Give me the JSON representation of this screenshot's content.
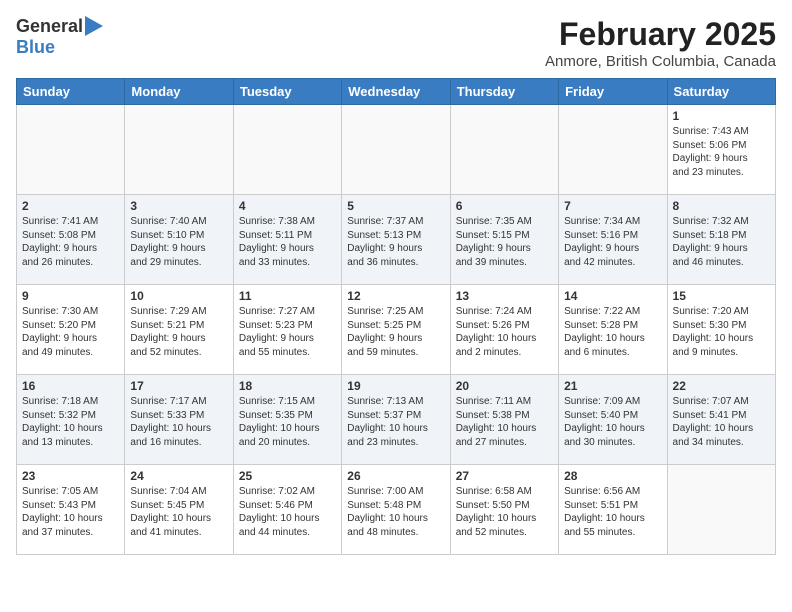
{
  "header": {
    "logo_general": "General",
    "logo_blue": "Blue",
    "title": "February 2025",
    "location": "Anmore, British Columbia, Canada"
  },
  "weekdays": [
    "Sunday",
    "Monday",
    "Tuesday",
    "Wednesday",
    "Thursday",
    "Friday",
    "Saturday"
  ],
  "weeks": [
    [
      {
        "day": "",
        "info": ""
      },
      {
        "day": "",
        "info": ""
      },
      {
        "day": "",
        "info": ""
      },
      {
        "day": "",
        "info": ""
      },
      {
        "day": "",
        "info": ""
      },
      {
        "day": "",
        "info": ""
      },
      {
        "day": "1",
        "info": "Sunrise: 7:43 AM\nSunset: 5:06 PM\nDaylight: 9 hours\nand 23 minutes."
      }
    ],
    [
      {
        "day": "2",
        "info": "Sunrise: 7:41 AM\nSunset: 5:08 PM\nDaylight: 9 hours\nand 26 minutes."
      },
      {
        "day": "3",
        "info": "Sunrise: 7:40 AM\nSunset: 5:10 PM\nDaylight: 9 hours\nand 29 minutes."
      },
      {
        "day": "4",
        "info": "Sunrise: 7:38 AM\nSunset: 5:11 PM\nDaylight: 9 hours\nand 33 minutes."
      },
      {
        "day": "5",
        "info": "Sunrise: 7:37 AM\nSunset: 5:13 PM\nDaylight: 9 hours\nand 36 minutes."
      },
      {
        "day": "6",
        "info": "Sunrise: 7:35 AM\nSunset: 5:15 PM\nDaylight: 9 hours\nand 39 minutes."
      },
      {
        "day": "7",
        "info": "Sunrise: 7:34 AM\nSunset: 5:16 PM\nDaylight: 9 hours\nand 42 minutes."
      },
      {
        "day": "8",
        "info": "Sunrise: 7:32 AM\nSunset: 5:18 PM\nDaylight: 9 hours\nand 46 minutes."
      }
    ],
    [
      {
        "day": "9",
        "info": "Sunrise: 7:30 AM\nSunset: 5:20 PM\nDaylight: 9 hours\nand 49 minutes."
      },
      {
        "day": "10",
        "info": "Sunrise: 7:29 AM\nSunset: 5:21 PM\nDaylight: 9 hours\nand 52 minutes."
      },
      {
        "day": "11",
        "info": "Sunrise: 7:27 AM\nSunset: 5:23 PM\nDaylight: 9 hours\nand 55 minutes."
      },
      {
        "day": "12",
        "info": "Sunrise: 7:25 AM\nSunset: 5:25 PM\nDaylight: 9 hours\nand 59 minutes."
      },
      {
        "day": "13",
        "info": "Sunrise: 7:24 AM\nSunset: 5:26 PM\nDaylight: 10 hours\nand 2 minutes."
      },
      {
        "day": "14",
        "info": "Sunrise: 7:22 AM\nSunset: 5:28 PM\nDaylight: 10 hours\nand 6 minutes."
      },
      {
        "day": "15",
        "info": "Sunrise: 7:20 AM\nSunset: 5:30 PM\nDaylight: 10 hours\nand 9 minutes."
      }
    ],
    [
      {
        "day": "16",
        "info": "Sunrise: 7:18 AM\nSunset: 5:32 PM\nDaylight: 10 hours\nand 13 minutes."
      },
      {
        "day": "17",
        "info": "Sunrise: 7:17 AM\nSunset: 5:33 PM\nDaylight: 10 hours\nand 16 minutes."
      },
      {
        "day": "18",
        "info": "Sunrise: 7:15 AM\nSunset: 5:35 PM\nDaylight: 10 hours\nand 20 minutes."
      },
      {
        "day": "19",
        "info": "Sunrise: 7:13 AM\nSunset: 5:37 PM\nDaylight: 10 hours\nand 23 minutes."
      },
      {
        "day": "20",
        "info": "Sunrise: 7:11 AM\nSunset: 5:38 PM\nDaylight: 10 hours\nand 27 minutes."
      },
      {
        "day": "21",
        "info": "Sunrise: 7:09 AM\nSunset: 5:40 PM\nDaylight: 10 hours\nand 30 minutes."
      },
      {
        "day": "22",
        "info": "Sunrise: 7:07 AM\nSunset: 5:41 PM\nDaylight: 10 hours\nand 34 minutes."
      }
    ],
    [
      {
        "day": "23",
        "info": "Sunrise: 7:05 AM\nSunset: 5:43 PM\nDaylight: 10 hours\nand 37 minutes."
      },
      {
        "day": "24",
        "info": "Sunrise: 7:04 AM\nSunset: 5:45 PM\nDaylight: 10 hours\nand 41 minutes."
      },
      {
        "day": "25",
        "info": "Sunrise: 7:02 AM\nSunset: 5:46 PM\nDaylight: 10 hours\nand 44 minutes."
      },
      {
        "day": "26",
        "info": "Sunrise: 7:00 AM\nSunset: 5:48 PM\nDaylight: 10 hours\nand 48 minutes."
      },
      {
        "day": "27",
        "info": "Sunrise: 6:58 AM\nSunset: 5:50 PM\nDaylight: 10 hours\nand 52 minutes."
      },
      {
        "day": "28",
        "info": "Sunrise: 6:56 AM\nSunset: 5:51 PM\nDaylight: 10 hours\nand 55 minutes."
      },
      {
        "day": "",
        "info": ""
      }
    ]
  ]
}
